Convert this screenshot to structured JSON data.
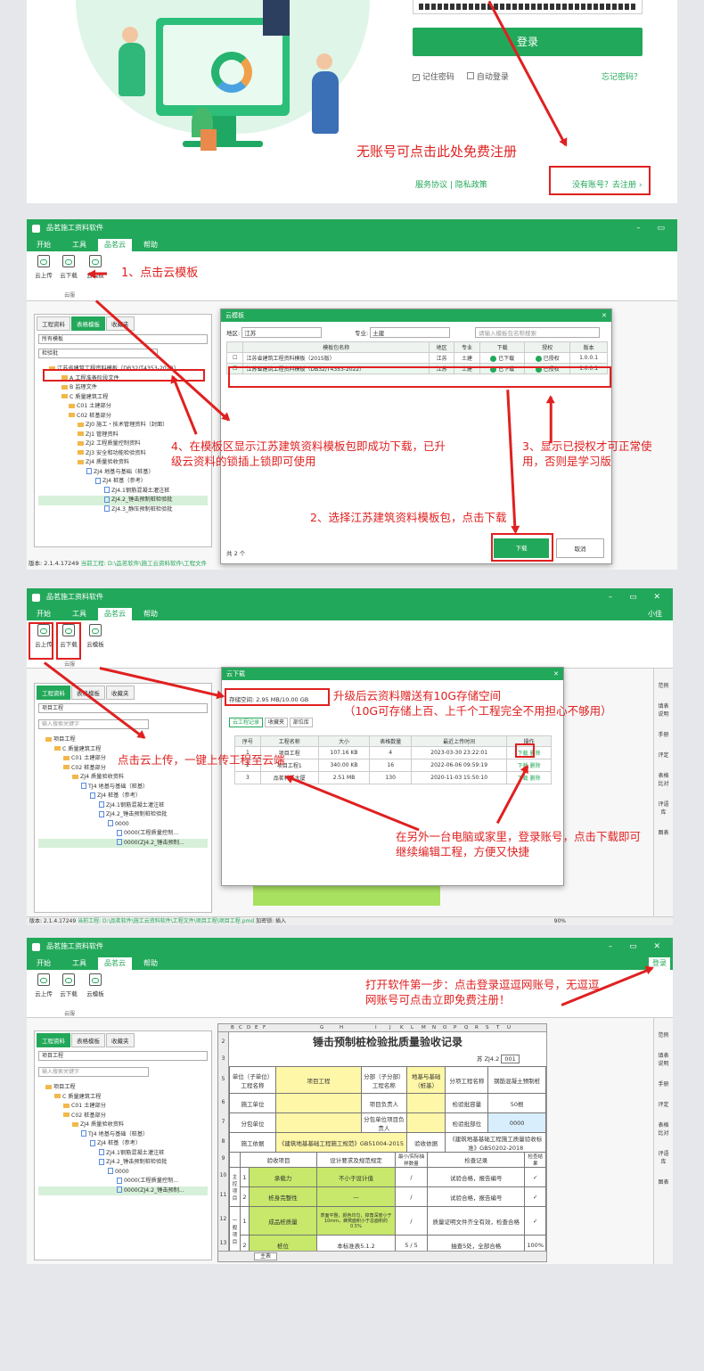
{
  "login": {
    "login_button": "登录",
    "remember_pwd": "记住密码",
    "auto_login": "自动登录",
    "forgot_pwd": "忘记密码？",
    "register_hint": "无账号可点击此处免费注册",
    "service_links": "服务协议 | 隐私政策",
    "register_link": "没有账号？去注册 ›"
  },
  "app": {
    "title": "品茗施工资料软件",
    "menu": [
      "开始",
      "工具",
      "品茗云",
      "帮助"
    ],
    "ribbon": [
      "云上传",
      "云下载",
      "云模板"
    ],
    "ribbon_group": "云服",
    "side_tabs": [
      "工程资料",
      "表格模板",
      "收藏夹"
    ],
    "search_placeholder": "输入搜索关键字",
    "right_sidebar": [
      "范例",
      "填表说明",
      "手册",
      "评定",
      "表格比对",
      "评语库",
      "图表"
    ],
    "version": "版本: 2.1.4.17249",
    "user": "小佳",
    "login_tag": "登录"
  },
  "panel2": {
    "tree_select": "所有模板",
    "tree_search": "检验批",
    "tree": [
      "江苏省建筑工程资料模板（DB32/T4353-2022）",
      "A 工程准备阶段文件",
      "B 监理文件",
      "C 质量建筑工程",
      "C01 土建部分",
      "C02 桩基部分",
      "ZJ0 施工・技术管理资料（封面）",
      "ZJ1 管理资料",
      "ZJ2 工程质量控制资料",
      "ZJ3 安全和功能检验资料",
      "ZJ4 质量验收资料",
      "ZJ4 地基与基础（桩基）",
      "ZJ4 桩基（参考）",
      "ZJ4.1钢筋混凝土灌注桩",
      "ZJ4.2_锤击预制桩检验批",
      "ZJ4.3_静压预制桩检验批"
    ],
    "status_path": "当前工程: D:\\品茗软件\\施工云资料软件\\工程文件",
    "dialog": {
      "title": "云模板",
      "region_label": "地区:",
      "region": "江苏",
      "major_label": "专业:",
      "major": "土建",
      "search_placeholder": "请输入模板包名称搜索",
      "headers": [
        "模板包名称",
        "地区",
        "专业",
        "下载",
        "授权",
        "版本"
      ],
      "rows": [
        {
          "name": "江苏省建筑工程资料模板（2015版）",
          "region": "江苏",
          "major": "土建",
          "download": "已下载",
          "auth": "已授权",
          "version": "1.0.0.1"
        },
        {
          "name": "江苏省建筑工程资料模板（DB32/T4353-2022）",
          "region": "江苏",
          "major": "土建",
          "download": "已下载",
          "auth": "已授权",
          "version": "1.0.0.1"
        }
      ],
      "count": "共 2 个",
      "download_btn": "下载",
      "cancel_btn": "取消"
    },
    "ann1": "1、点击云模板",
    "ann2": "2、选择江苏建筑资料模板包，点击下载",
    "ann3": "3、显示已授权才可正常使用，否则是学习版",
    "ann4": "4、在模板区显示江苏建筑资料模板包即成功下载，已升级云资料的锁插上锁即可使用"
  },
  "panel3": {
    "tree_select": "项目工程",
    "tree": [
      "项目工程",
      "C 质量建筑工程",
      "C01 土建部分",
      "C02 桩基部分",
      "ZJ4 质量验收资料",
      "TJ4 地基与基础（桩基）",
      "ZJ4 桩基（参考）",
      "ZJ4.1钢筋混凝土灌注桩",
      "ZJ4.2_锤击预制桩检验批",
      "0000",
      "0000(工程质量控制...",
      "0000(ZJ4.2_锤击预制..."
    ],
    "status_path": "当前工程: D:\\品茗软件\\施工云资料软件\\工程文件\\项目工程\\项目工程.pmd",
    "status_extra": "加密锁: 插入",
    "zoom": "90%",
    "dialog": {
      "title": "云下载",
      "storage": "存储空间: 2.95 MB/10.00 GB",
      "tabs": [
        "云工程记录",
        "收藏夹",
        "部位库"
      ],
      "headers": [
        "序号",
        "工程名称",
        "大小",
        "表格数量",
        "最近上传时间",
        "操作"
      ],
      "rows": [
        {
          "no": "1",
          "name": "项目工程",
          "size": "107.16 KB",
          "count": "4",
          "time": "2023-03-30 23:22:01",
          "op": "下载 删除"
        },
        {
          "no": "2",
          "name": "项目工程1",
          "size": "340.00 KB",
          "count": "16",
          "time": "2022-06-06 09:59:19",
          "op": "下载 删除"
        },
        {
          "no": "3",
          "name": "品茗科技大厦",
          "size": "2.51 MB",
          "count": "130",
          "time": "2020-11-03 15:50:10",
          "op": "下载 删除"
        }
      ]
    },
    "ann_storage_1": "升级后云资料赠送有10G存储空间",
    "ann_storage_2": "（10G可存储上百、上千个工程完全不用担心不够用）",
    "ann_upload": "点击云上传，一键上传工程至云端",
    "ann_download": "在另外一台电脑或家里，登录账号，点击下载即可继续编辑工程，方便又快捷"
  },
  "panel4": {
    "tree_select": "项目工程",
    "ann": "打开软件第一步：点击登录逗逗网账号，无逗逗网账号可点击立即免费注册！",
    "sheet": {
      "title": "锤击预制桩检验批质量验收记录",
      "code_label": "苏 ZJ4.2",
      "code": "001",
      "row5": [
        "单位（子单位）工程名称",
        "项目工程",
        "分部（子分部）工程名称",
        "地基与基础（桩基）",
        "分项工程名称",
        "钢筋混凝土预制桩"
      ],
      "row6": [
        "施工单位",
        "",
        "项目负责人",
        "",
        "检验批容量",
        "50根"
      ],
      "row7": [
        "分包单位",
        "",
        "分包单位项目负责人",
        "",
        "检验批部位",
        "0000"
      ],
      "row8": [
        "施工依据",
        "《建筑地基基础工程施工规范》GB51004-2015",
        "验收依据",
        "《建筑地基基础工程施工质量验收标准》GB50202-2018"
      ],
      "row9": [
        "验收项目",
        "设计要求及规范规定",
        "最小/实际抽样数量",
        "检查记录",
        "检查结果"
      ],
      "items": [
        {
          "no": "1",
          "name": "承载力",
          "req": "不小于设计值",
          "sample": "/",
          "record": "试验合格，报告编号",
          "result": "✓"
        },
        {
          "no": "2",
          "name": "桩身完整性",
          "req": "—",
          "sample": "/",
          "record": "试验合格，报告编号",
          "result": "✓"
        },
        {
          "no": "1",
          "name": "成品桩质量",
          "req": "表面平整，颜色均匀，掉角深度小于10mm，蜂窝面积小于总面积的0.5%",
          "sample": "/",
          "record": "质量证明文件齐全有效，检查合格",
          "result": "✓"
        },
        {
          "no": "2",
          "name": "桩位",
          "req": "本标准表5.1.2",
          "sample": "5 / 5",
          "record": "抽查5处，全部合格",
          "result": "100%"
        }
      ],
      "rownums": [
        "2",
        "3",
        "5",
        "6",
        "7",
        "8",
        "9",
        "10",
        "11",
        "12",
        "13"
      ],
      "cols": [
        "B",
        "C",
        "D",
        "E",
        "F",
        "G",
        "H",
        "I",
        "J",
        "K",
        "L",
        "M",
        "N",
        "O",
        "P",
        "Q",
        "R",
        "S",
        "T",
        "U"
      ],
      "sheet_tab": "主表",
      "side_labels": [
        "主控项目",
        "一般项目"
      ]
    }
  }
}
